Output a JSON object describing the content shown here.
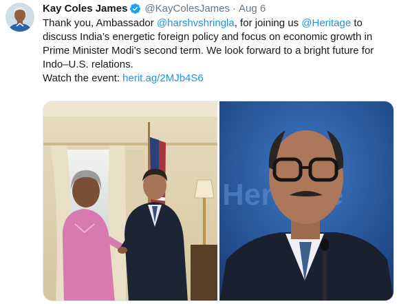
{
  "tweet": {
    "author_name": "Kay Coles James",
    "verified_icon": "verified-badge-icon",
    "handle": "@KayColesJames",
    "separator": "·",
    "date": "Aug 6",
    "text_part1": "Thank you, Ambassador ",
    "mention1": "@harshvshringla",
    "text_part2": ", for joining us ",
    "mention2": "@Heritage",
    "text_part3": " to discuss India’s energetic foreign policy and focus on economic growth in Prime Minister Modi’s second term. We look forward to a bright future for Indo–U.S. relations.",
    "watch_label": "Watch the event: ",
    "watch_link": "herit.ag/2MJb4S6",
    "photo_backdrop_text": "Heritage"
  },
  "colors": {
    "link": "#1b95e0",
    "secondary": "#657786",
    "verified": "#1da1f2"
  }
}
